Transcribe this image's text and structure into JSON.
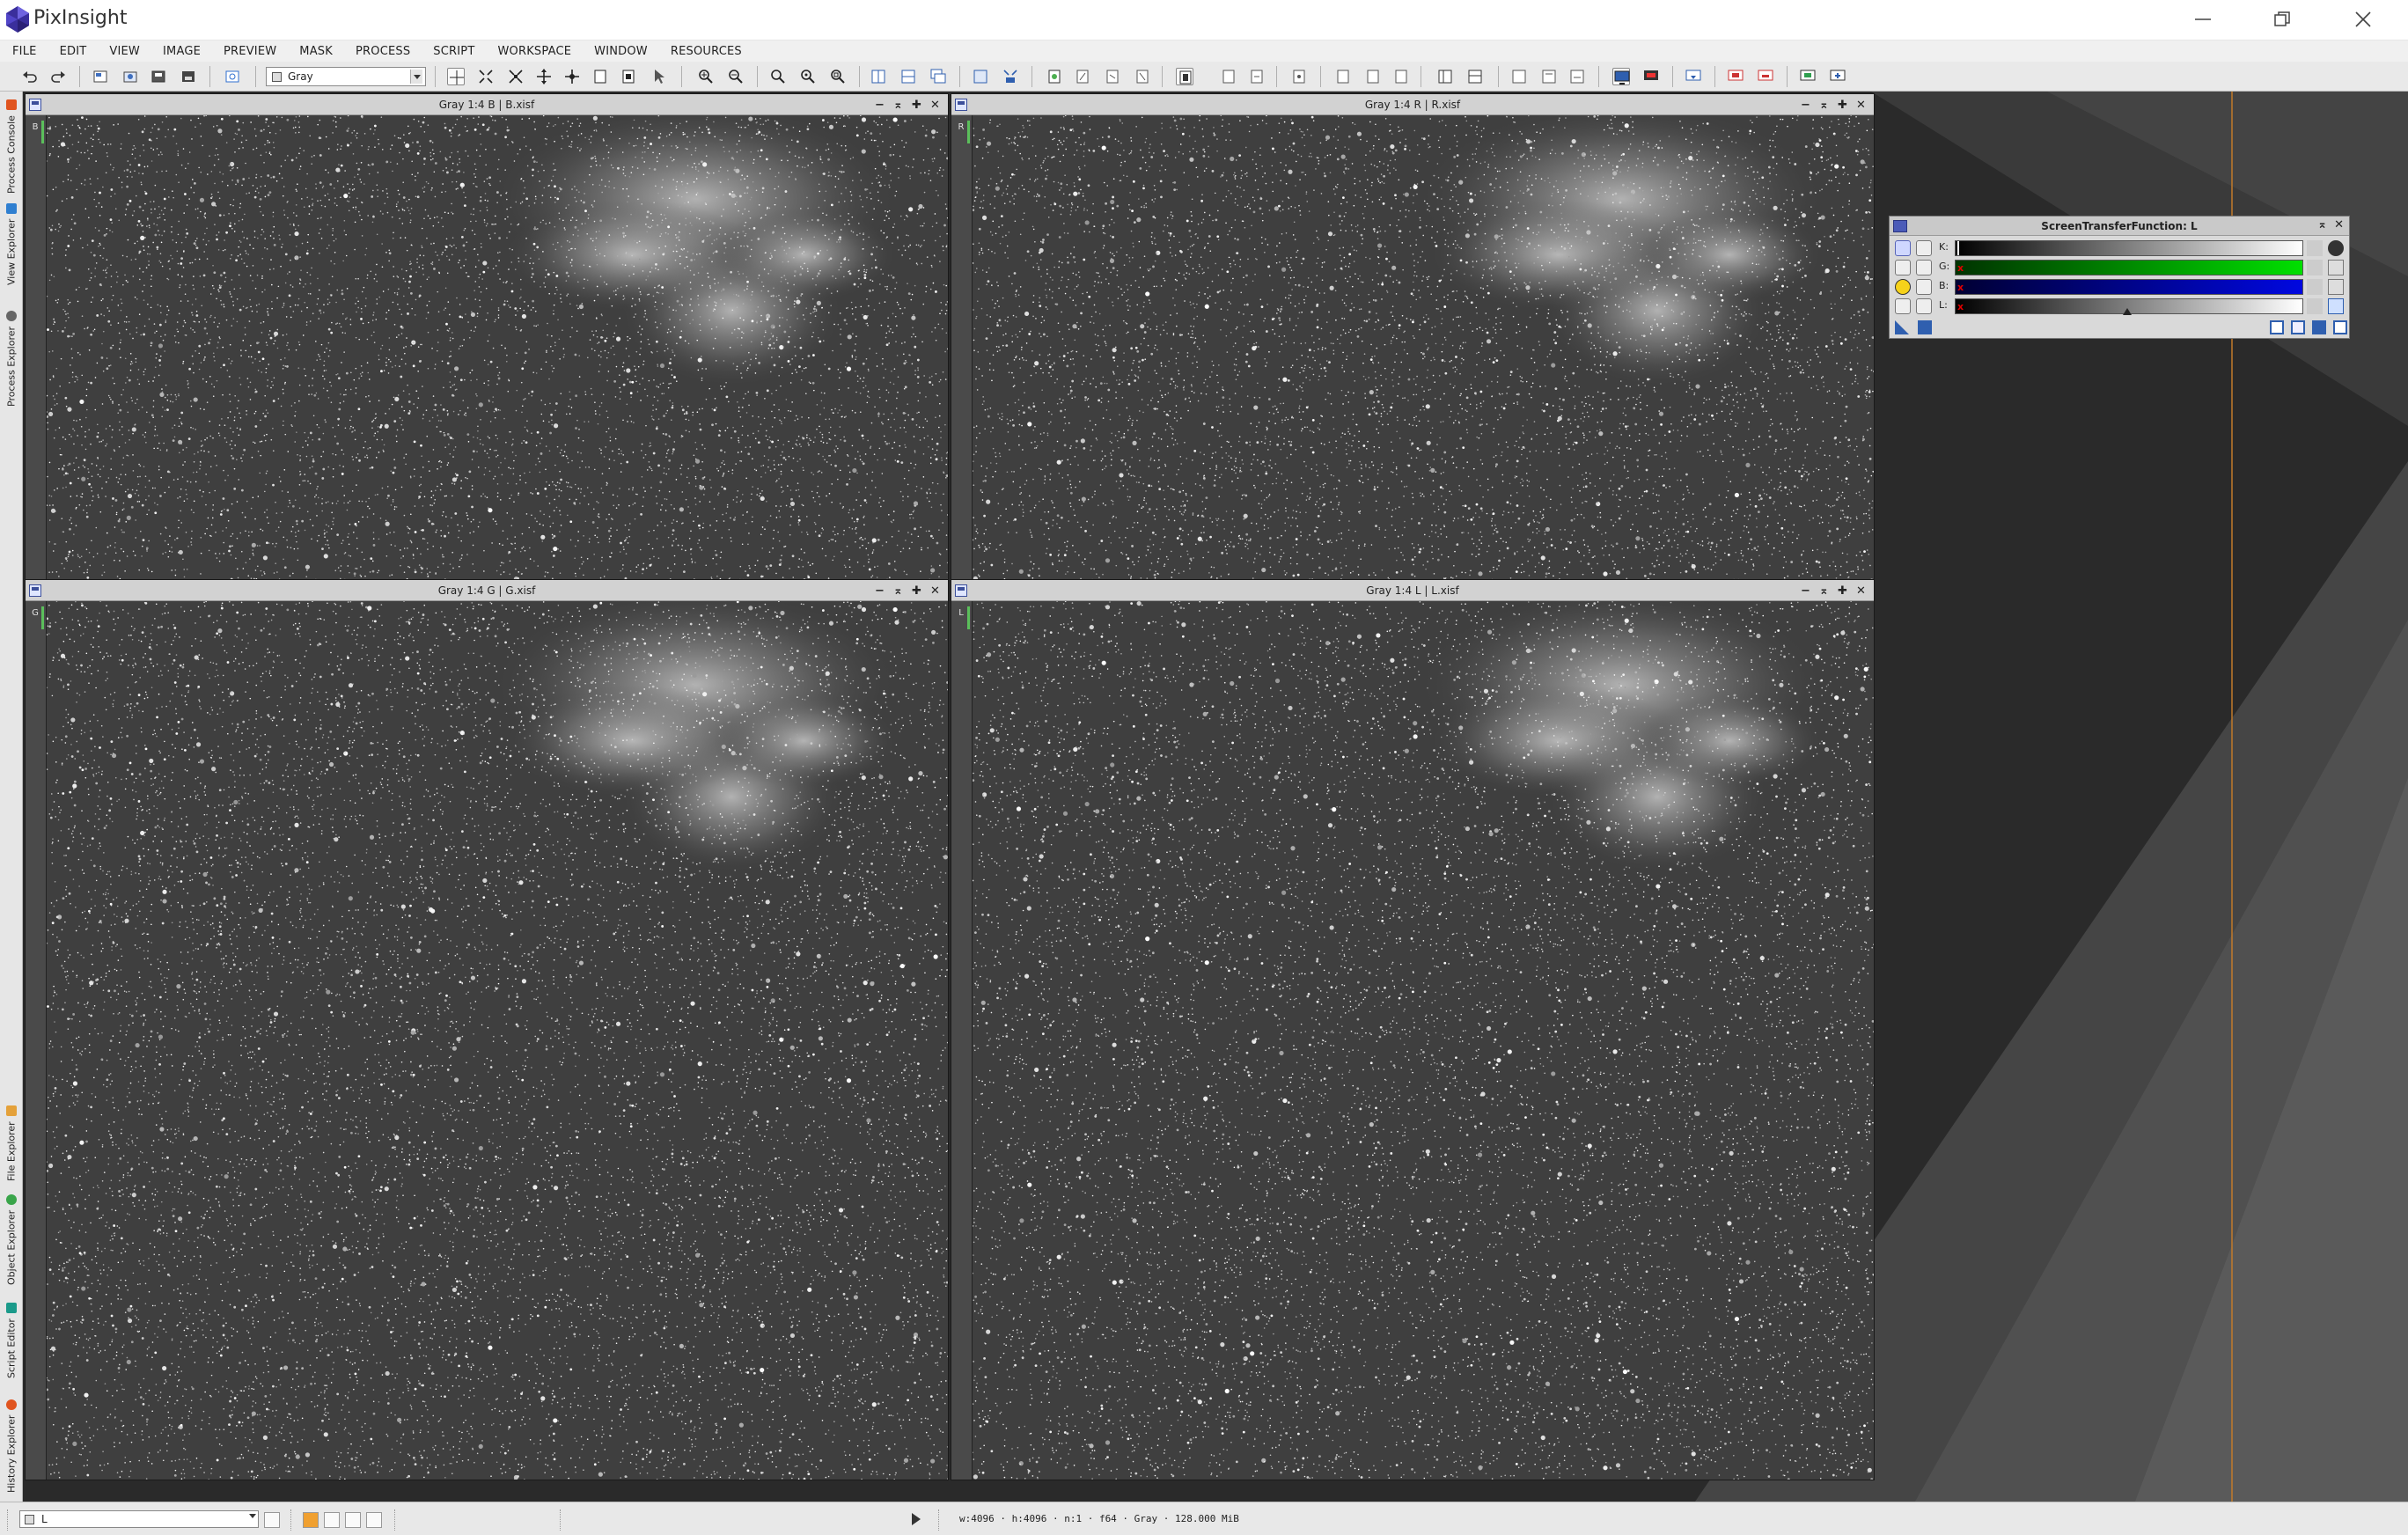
{
  "app": {
    "title": "PixInsight"
  },
  "menubar": {
    "items": [
      "FILE",
      "EDIT",
      "VIEW",
      "IMAGE",
      "PREVIEW",
      "MASK",
      "PROCESS",
      "SCRIPT",
      "WORKSPACE",
      "WINDOW",
      "RESOURCES"
    ]
  },
  "toolbar": {
    "image_combo_value": "Gray"
  },
  "left_dock": {
    "tabs": [
      "Process Console",
      "View Explorer",
      "Process Explorer",
      "File Explorer",
      "Object Explorer",
      "Script Editor",
      "History Explorer"
    ]
  },
  "image_windows": [
    {
      "title": "Gray 1:4 B | B.xisf",
      "id_letter": "B"
    },
    {
      "title": "Gray 1:4 R | R.xisf",
      "id_letter": "R"
    },
    {
      "title": "Gray 1:4 G | G.xisf",
      "id_letter": "G"
    },
    {
      "title": "Gray 1:4 L | L.xisf",
      "id_letter": "L"
    }
  ],
  "stf_window": {
    "title": "ScreenTransferFunction: L",
    "rows": [
      {
        "label": "K:",
        "color": "#000000"
      },
      {
        "label": "G:",
        "color": "#00cc00"
      },
      {
        "label": "B:",
        "color": "#0000cc"
      },
      {
        "label": "L:",
        "color": "#808080"
      }
    ]
  },
  "statusbar": {
    "view_combo_value": "L",
    "info": "w:4096 · h:4096 · n:1 · f64 · Gray · 128.000 MiB"
  },
  "colors": {
    "accent_green": "#5bbf5b",
    "stf_green": "#00d000",
    "stf_blue": "#0008d8",
    "workspace_bg": "#262626",
    "logo_purple": "#4b3fb8",
    "orange_guide": "#c27a2a"
  }
}
